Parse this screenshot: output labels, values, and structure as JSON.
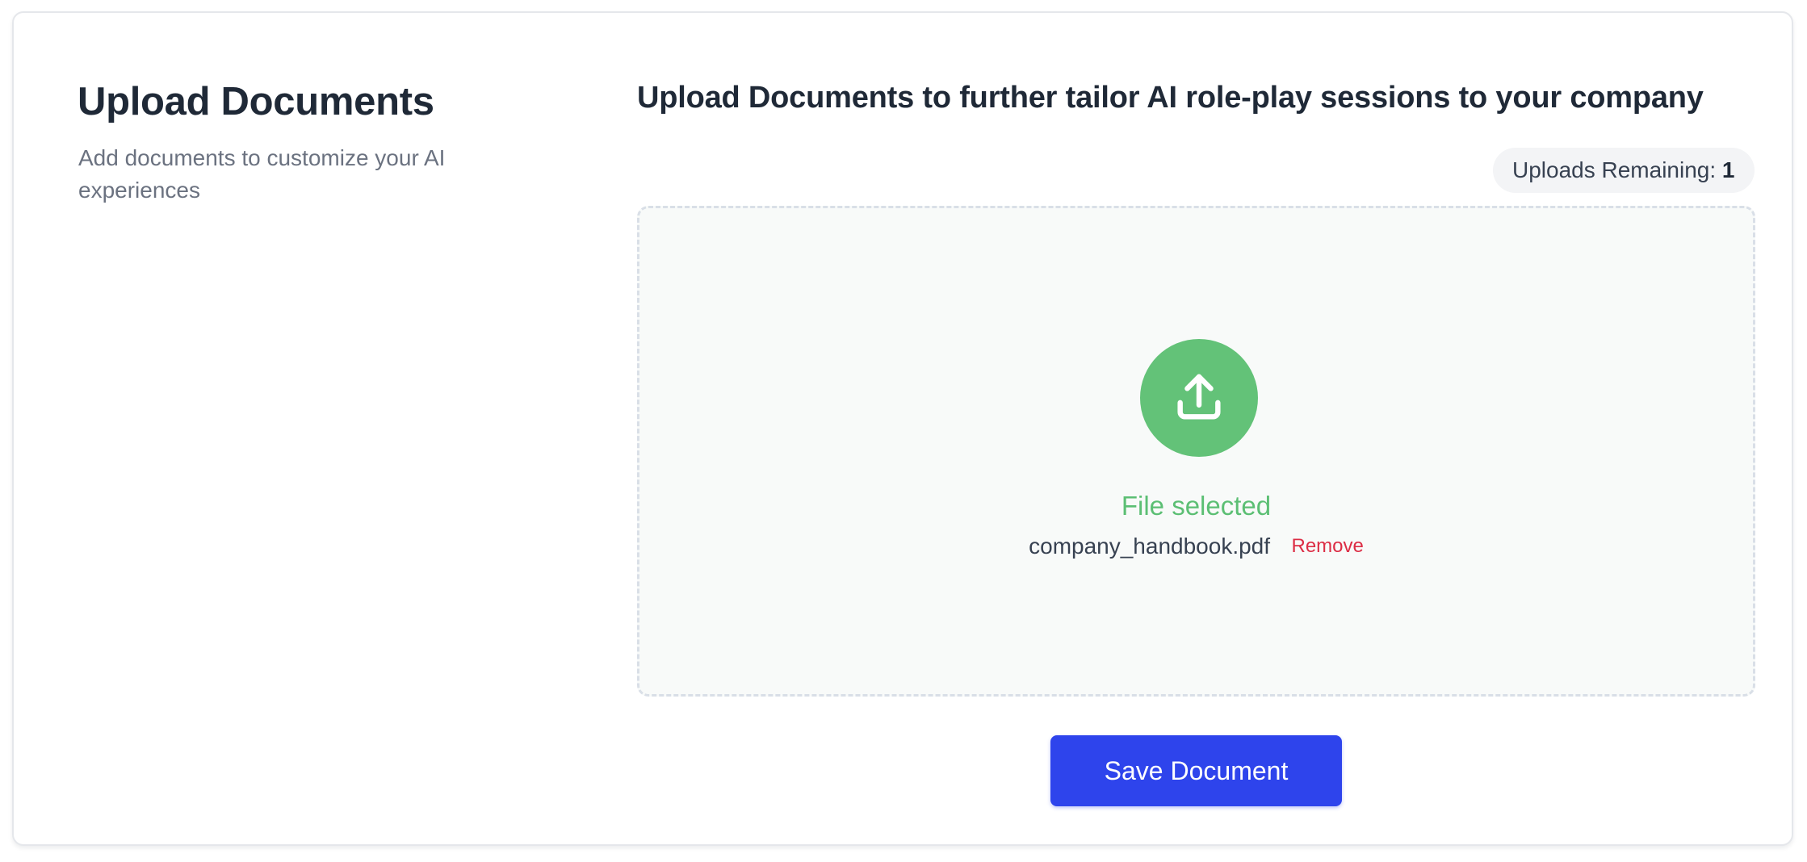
{
  "sidebar": {
    "title": "Upload Documents",
    "description": "Add documents to customize your AI experiences"
  },
  "main": {
    "title": "Upload Documents to further tailor AI role-play sessions to your company",
    "uploads_remaining_label": "Uploads Remaining:",
    "uploads_remaining_count": "1"
  },
  "dropzone": {
    "icon": "upload-icon",
    "status": "File selected",
    "file_name": "company_handbook.pdf",
    "remove_label": "Remove"
  },
  "actions": {
    "save_label": "Save Document"
  },
  "colors": {
    "accent": "#2e44ec",
    "success": "#63c278",
    "danger": "#dc2d45"
  }
}
